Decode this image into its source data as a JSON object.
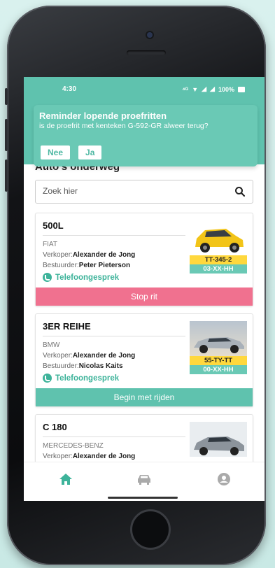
{
  "status_bar": {
    "time": "4:30",
    "battery": "100%"
  },
  "reminder": {
    "title": "Reminder lopende proefritten",
    "message": "is de proefrit met kenteken G-592-GR alweer terug?",
    "no_label": "Nee",
    "yes_label": "Ja"
  },
  "section_title": "Auto's onderweg",
  "search": {
    "placeholder": "Zoek hier"
  },
  "labels": {
    "seller": "Verkoper:",
    "driver": "Bestuurder:",
    "phone": "Telefoongesprek"
  },
  "cars": [
    {
      "model": "500L",
      "brand": "FIAT",
      "seller": "Alexander de Jong",
      "driver": "Peter Pieterson",
      "plate": "TT-345-2",
      "plate_secondary": "03-XX-HH",
      "action": "Stop rit",
      "action_color": "#f0718f"
    },
    {
      "model": "3ER REIHE",
      "brand": "BMW",
      "seller": "Alexander de Jong",
      "driver": "Nicolas Kaits",
      "plate": "55-TY-TT",
      "plate_secondary": "00-XX-HH",
      "action": "Begin met rijden",
      "action_color": "#5fc2ae"
    },
    {
      "model": "C 180",
      "brand": "MERCEDES-BENZ",
      "seller": "Alexander de Jong"
    }
  ],
  "nav": {
    "items": [
      "home-icon",
      "car-icon",
      "account-icon"
    ],
    "active_color": "#3db39a",
    "inactive_color": "#aaaaaa"
  },
  "colors": {
    "brand_teal": "#5fc2ae",
    "stop_pink": "#f0718f",
    "plate_yellow": "#ffd83d"
  }
}
